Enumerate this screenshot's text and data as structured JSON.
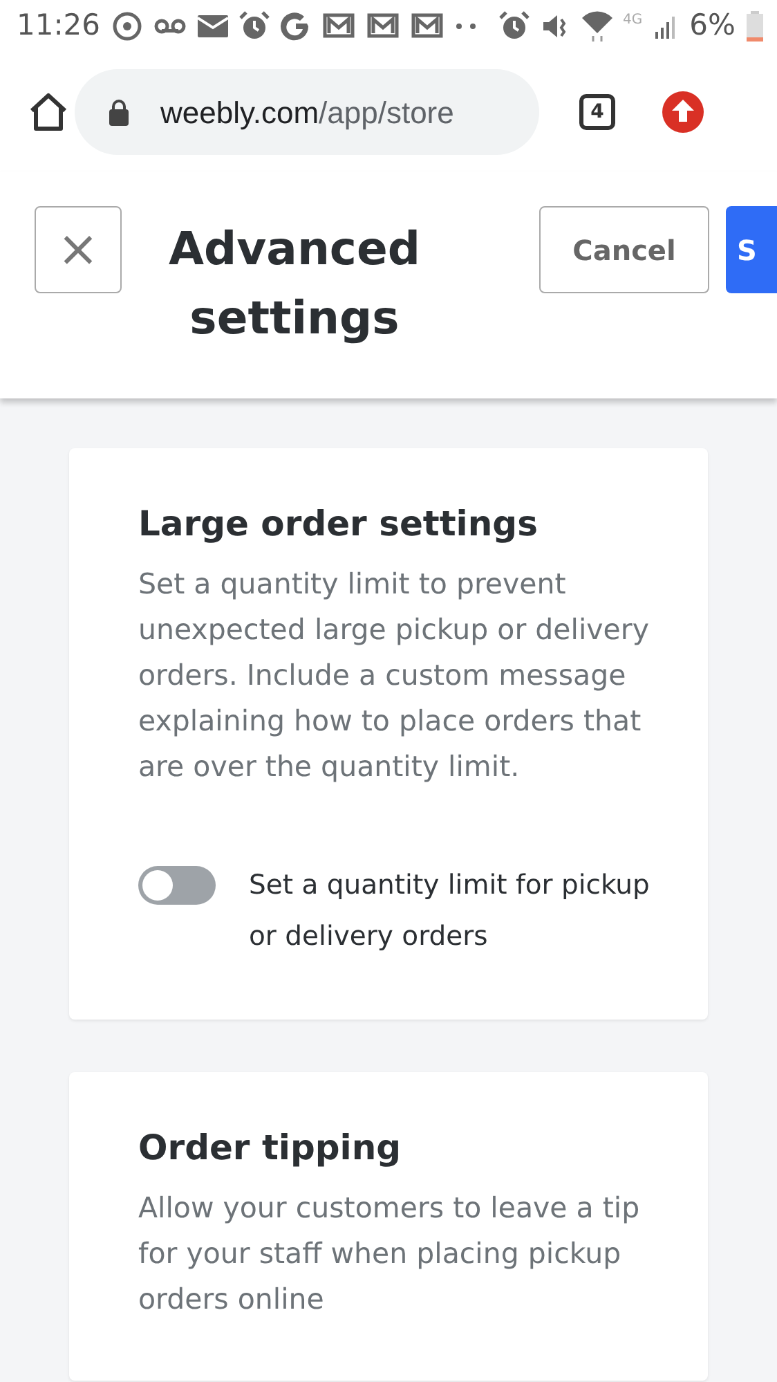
{
  "status_bar": {
    "time": "11:26",
    "network_type": "4G",
    "battery": "6%"
  },
  "browser": {
    "url_host": "weebly.com",
    "url_path": "/app/store",
    "tab_count": "4"
  },
  "header": {
    "close_label": "×",
    "title": "Advanced settings",
    "cancel_label": "Cancel",
    "save_label": "S"
  },
  "cards": [
    {
      "title": "Large order settings",
      "description": "Set a quantity limit to prevent unexpected large pickup or delivery orders. Include a custom message explaining how to place orders that are over the quantity limit.",
      "toggle": {
        "label": "Set a quantity limit for pickup or delivery orders",
        "on": false
      }
    },
    {
      "title": "Order tipping",
      "description": "Allow your customers to leave a tip for your staff when placing pickup orders online"
    }
  ]
}
